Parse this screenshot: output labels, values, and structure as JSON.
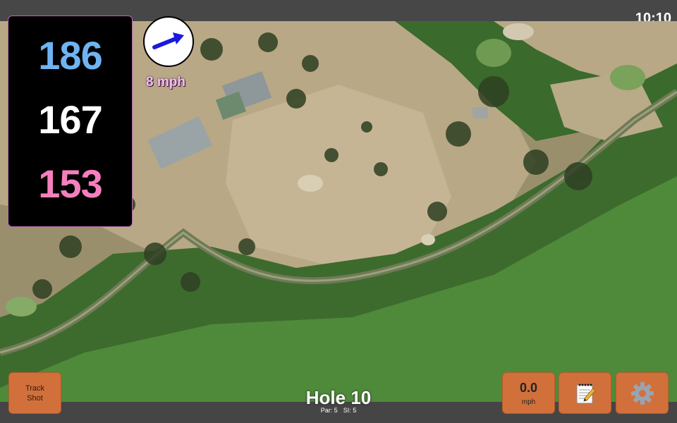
{
  "status": {
    "time": "10:10"
  },
  "distances": {
    "back": "186",
    "middle": "167",
    "front": "153"
  },
  "wind": {
    "speed": "8 mph",
    "arrow_icon": "wind-arrow-icon"
  },
  "hole": {
    "title": "Hole 10",
    "par": "Par: 5",
    "si": "SI: 5"
  },
  "buttons": {
    "track_shot_line1": "Track",
    "track_shot_line2": "Shot",
    "speed_value": "0.0",
    "speed_unit": "mph",
    "notes_icon": "notepad-icon",
    "settings_icon": "gear-icon"
  },
  "colors": {
    "back_distance": "#6fb3f1",
    "middle_distance": "#ffffff",
    "front_distance": "#f57fbe",
    "button_orange": "#d2703b",
    "wind_arrow": "#1a1adc"
  }
}
